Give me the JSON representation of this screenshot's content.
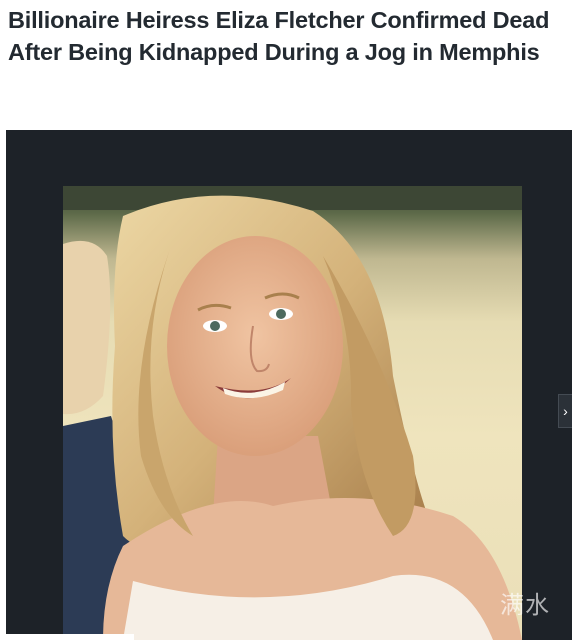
{
  "article": {
    "headline": "Billionaire Heiress Eliza Fletcher Confirmed Dead After Being Kidnapped During a Jog in Memphis"
  },
  "media": {
    "next_icon": "chevron-right-icon",
    "next_glyph": "›",
    "watermark": "满水"
  },
  "colors": {
    "headline": "#232a31",
    "media_background": "#1d2228",
    "page_background": "#ffffff"
  }
}
